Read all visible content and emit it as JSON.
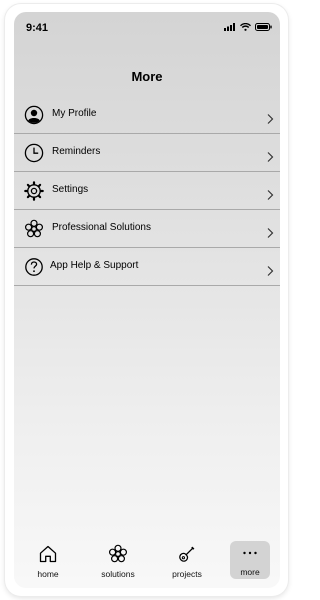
{
  "status_bar": {
    "time": "9:41"
  },
  "header": {
    "title": "More"
  },
  "menu": {
    "items": [
      {
        "label": "My Profile",
        "icon": "user-circle-icon"
      },
      {
        "label": "Reminders",
        "icon": "clock-icon"
      },
      {
        "label": "Settings",
        "icon": "gear-icon"
      },
      {
        "label": "Professional Solutions",
        "icon": "flower-icon"
      },
      {
        "label": "App Help & Support",
        "icon": "question-circle-icon"
      }
    ]
  },
  "tab_bar": {
    "active": "more",
    "tabs": [
      {
        "label": "home",
        "icon": "house-icon"
      },
      {
        "label": "solutions",
        "icon": "flower-icon"
      },
      {
        "label": "projects",
        "icon": "guitar-icon"
      },
      {
        "label": "more",
        "icon": "ellipsis-icon"
      }
    ]
  }
}
